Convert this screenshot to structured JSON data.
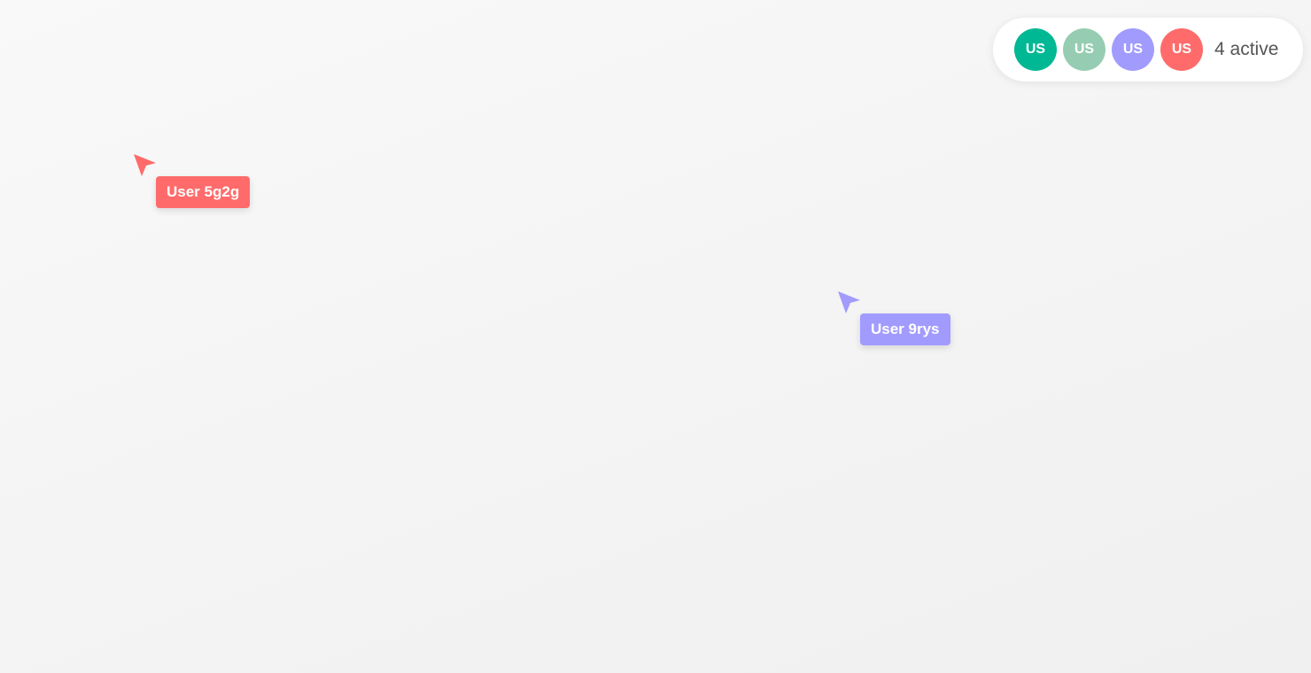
{
  "presence": {
    "avatars": [
      {
        "initials": "US",
        "color": "#00b894"
      },
      {
        "initials": "US",
        "color": "#96cdb2"
      },
      {
        "initials": "US",
        "color": "#a29bfe"
      },
      {
        "initials": "US",
        "color": "#ff6b6b"
      }
    ],
    "active_label": "4 active"
  },
  "cursors": [
    {
      "name": "User 5g2g",
      "color": "#ff6b6b",
      "icon": "cursor-arrow-icon"
    },
    {
      "name": "User 9rys",
      "color": "#a29bfe",
      "icon": "cursor-arrow-icon"
    }
  ]
}
